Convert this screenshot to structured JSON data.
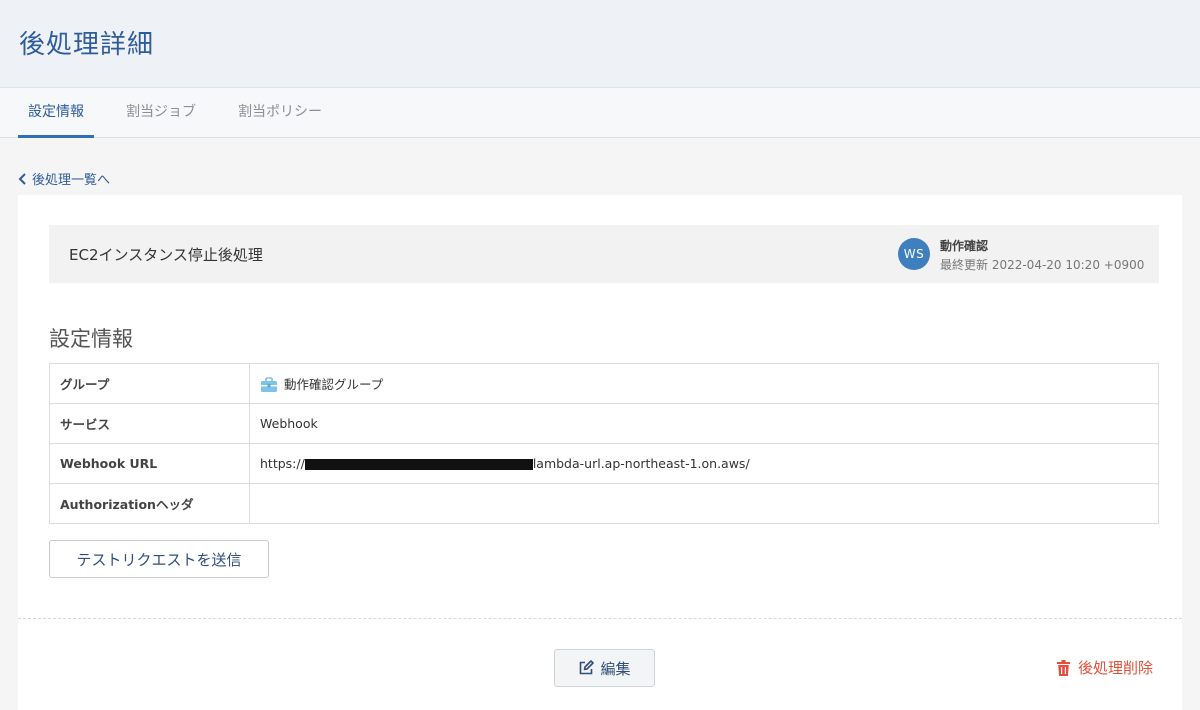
{
  "header": {
    "title": "後処理詳細"
  },
  "tabs": [
    {
      "label": "設定情報",
      "active": true
    },
    {
      "label": "割当ジョブ",
      "active": false
    },
    {
      "label": "割当ポリシー",
      "active": false
    }
  ],
  "back_link": {
    "label": "後処理一覧へ",
    "icon": "chevron-left-icon"
  },
  "summary": {
    "name": "EC2インスタンス停止後処理",
    "avatar_initials": "WS",
    "user_name": "動作確認",
    "last_updated": "最終更新 2022-04-20 10:20 +0900"
  },
  "settings": {
    "title": "設定情報",
    "rows": [
      {
        "key": "グループ",
        "value": "動作確認グループ",
        "icon": "briefcase-icon"
      },
      {
        "key": "サービス",
        "value": "Webhook"
      },
      {
        "key": "Webhook URL",
        "value_prefix": "https://",
        "value_suffix": "lambda-url.ap-northeast-1.on.aws/"
      },
      {
        "key": "Authorizationヘッダ",
        "value": ""
      }
    ]
  },
  "buttons": {
    "test_request": "テストリクエストを送信",
    "edit": "編集",
    "delete": "後処理削除"
  },
  "colors": {
    "accent": "#2e5c9a",
    "avatar": "#3d7fbf",
    "danger": "#e0503a",
    "group_icon": "#7ec3e6"
  }
}
